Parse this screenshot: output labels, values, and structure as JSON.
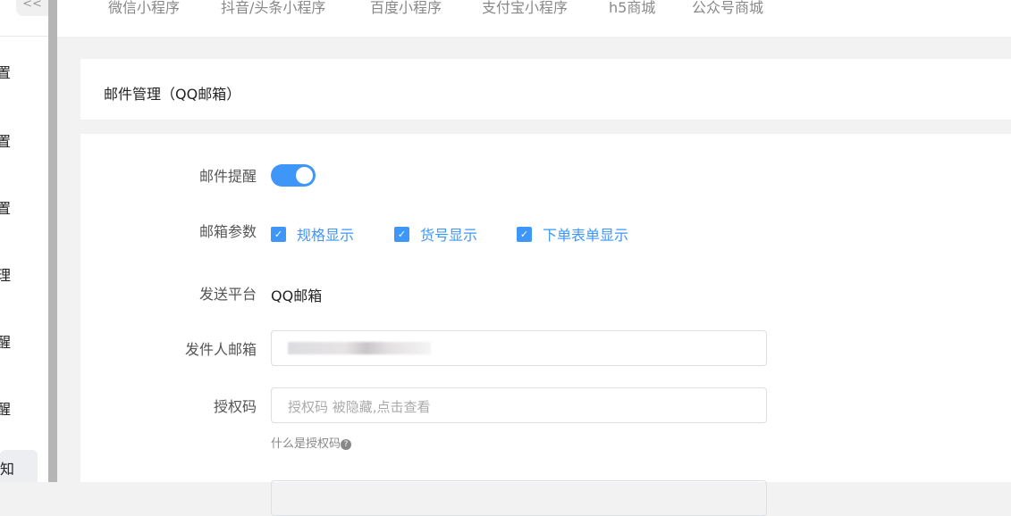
{
  "sidebar": {
    "collapse_label": "<<",
    "items": [
      "置",
      "置",
      "置",
      "理",
      "醒",
      "醒",
      "知"
    ]
  },
  "tabs": [
    "微信小程序",
    "抖音/头条小程序",
    "百度小程序",
    "支付宝小程序",
    "h5商城",
    "公众号商城"
  ],
  "header": {
    "title": "邮件管理（QQ邮箱）"
  },
  "form": {
    "email_alert_label": "邮件提醒",
    "email_alert_on": true,
    "params_label": "邮箱参数",
    "params": [
      {
        "label": "规格显示",
        "checked": true
      },
      {
        "label": "货号显示",
        "checked": true
      },
      {
        "label": "下单表单显示",
        "checked": true
      }
    ],
    "platform_label": "发送平台",
    "platform_value": "QQ邮箱",
    "sender_label": "发件人邮箱",
    "auth_label": "授权码",
    "auth_placeholder": "授权码 被隐藏,点击查看",
    "auth_help": "什么是授权码",
    "help_icon": "?"
  },
  "colors": {
    "accent": "#3e97f8"
  }
}
